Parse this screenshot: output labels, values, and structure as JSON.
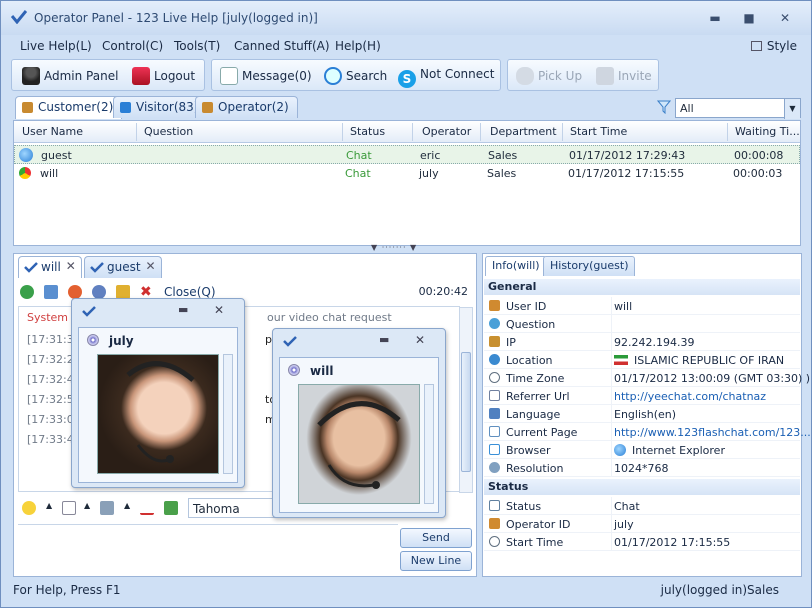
{
  "window": {
    "title": "Operator Panel - 123 Live Help [july(logged in)]"
  },
  "menu": {
    "items": [
      "Live Help(L)",
      "Control(C)",
      "Tools(T)",
      "Canned Stuff(A)",
      "Help(H)"
    ],
    "style": "Style"
  },
  "toolbar": {
    "admin_panel": "Admin Panel",
    "logout": "Logout",
    "message": "Message(0)",
    "search": "Search",
    "not_connect": "Not Connect",
    "pick_up": "Pick Up",
    "invite": "Invite"
  },
  "top_tabs": [
    "Customer(2)",
    "Visitor(83)",
    "Operator(2)"
  ],
  "filter": {
    "value": "All"
  },
  "grid": {
    "columns": [
      "User Name",
      "Question",
      "Status",
      "Operator",
      "Department",
      "Start Time",
      "Waiting Ti..."
    ],
    "rows": [
      {
        "user": "guest",
        "question": "",
        "status": "Chat",
        "operator": "eric",
        "department": "Sales",
        "start": "01/17/2012 17:29:43",
        "waiting": "00:00:08"
      },
      {
        "user": "will",
        "question": "",
        "status": "Chat",
        "operator": "july",
        "department": "Sales",
        "start": "01/17/2012 17:15:55",
        "waiting": "00:00:03"
      }
    ]
  },
  "chat": {
    "tabs": [
      "will",
      "guest"
    ],
    "close_label": "Close(Q)",
    "timer": "00:20:42",
    "log": [
      {
        "text": "System",
        "sys": true,
        "extra": "our video chat request"
      },
      {
        "text": "[17:31:3",
        "extra": "p for"
      },
      {
        "text": "[17:32:2",
        "extra": ""
      },
      {
        "text": "[17:32:4",
        "extra": ""
      },
      {
        "text": "[17:32:5",
        "extra": "to my"
      },
      {
        "text": "[17:33:0",
        "extra": "mail?"
      },
      {
        "text": "[17:33:4",
        "extra": ""
      }
    ],
    "font": "Tahoma",
    "send": "Send",
    "new_line": "New Line"
  },
  "video": {
    "july": {
      "name": "july"
    },
    "will": {
      "name": "will"
    }
  },
  "info": {
    "tabs": [
      "Info(will)",
      "History(guest)"
    ],
    "general_title": "General",
    "general": [
      {
        "k": "User ID",
        "v": "will",
        "color": "#d08a30"
      },
      {
        "k": "Question",
        "v": "",
        "color": "#4aa0d8"
      },
      {
        "k": "IP",
        "v": "92.242.194.39",
        "color": "#c89030"
      },
      {
        "k": "Location",
        "v": "ISLAMIC REPUBLIC OF IRAN",
        "color": "#3a8ad0"
      },
      {
        "k": "Time Zone",
        "v": "01/17/2012 13:00:09 (GMT 03:30) )",
        "color": "#607080"
      },
      {
        "k": "Referrer Url",
        "v": "http://yeechat.com/chatnaz",
        "link": true,
        "color": "#7080a0"
      },
      {
        "k": "Language",
        "v": "English(en)",
        "color": "#5080c0"
      },
      {
        "k": "Current Page",
        "v": "http://www.123flashchat.com/123...",
        "link": true,
        "color": "#6090c0"
      },
      {
        "k": "Browser",
        "v": "Internet Explorer",
        "color": "#3a90d8"
      },
      {
        "k": "Resolution",
        "v": "1024*768",
        "color": "#80a0c0"
      }
    ],
    "status_title": "Status",
    "status": [
      {
        "k": "Status",
        "v": "Chat",
        "color": "#6080a0"
      },
      {
        "k": "Operator ID",
        "v": "july",
        "color": "#d08a30"
      },
      {
        "k": "Start Time",
        "v": "01/17/2012 17:15:55",
        "color": "#607080"
      }
    ]
  },
  "statusbar": {
    "left": "For Help, Press F1",
    "right": "july(logged in)Sales"
  }
}
